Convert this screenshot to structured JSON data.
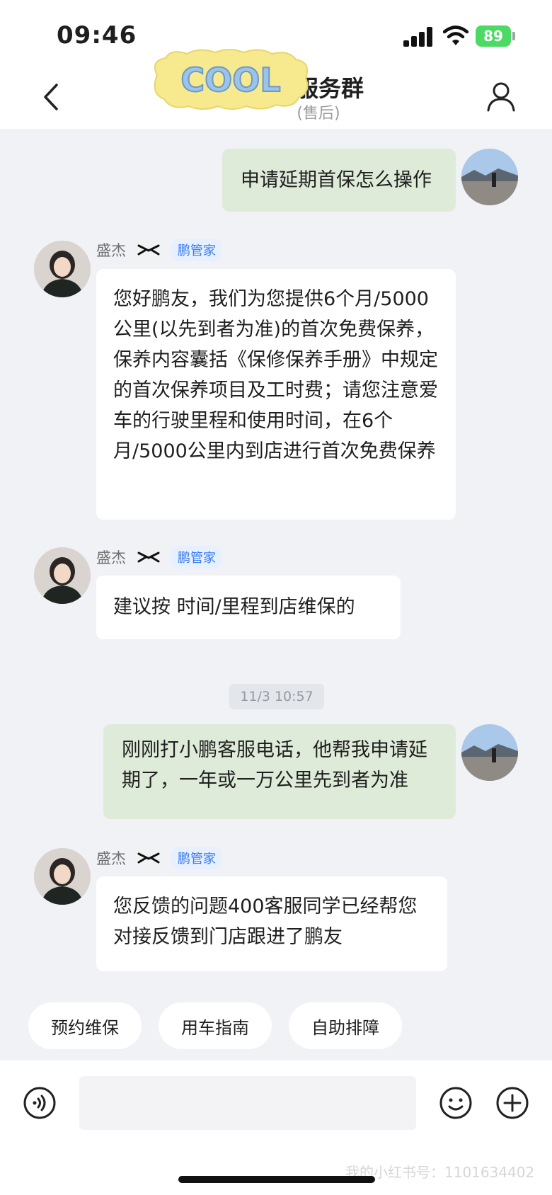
{
  "status_bar": {
    "time": "09:46",
    "battery": "89"
  },
  "header": {
    "title": "家服务群",
    "subtitle": "(售后)",
    "sticker_text": "COOL"
  },
  "messages": [
    {
      "id": "m1",
      "direction": "outgoing",
      "text": "申请延期首保怎么操作"
    },
    {
      "id": "m2",
      "direction": "incoming",
      "sender": "盛杰",
      "role_tag": "鹏管家",
      "text": "您好鹏友，我们为您提供6个月/5000公里(以先到者为准)的首次免费保养，保养内容囊括《保修保养手册》中规定的首次保养项目及工时费；请您注意爱车的行驶里程和使用时间，在6个月/5000公里内到店进行首次免费保养"
    },
    {
      "id": "m3",
      "direction": "incoming",
      "sender": "盛杰",
      "role_tag": "鹏管家",
      "text": "建议按   时间/里程到店维保的"
    },
    {
      "id": "ts1",
      "type": "timestamp",
      "text": "11/3 10:57"
    },
    {
      "id": "m4",
      "direction": "outgoing",
      "text": "刚刚打小鹏客服电话，他帮我申请延期了，一年或一万公里先到者为准"
    },
    {
      "id": "m5",
      "direction": "incoming",
      "sender": "盛杰",
      "role_tag": "鹏管家",
      "text": "您反馈的问题400客服同学已经帮您对接反馈到门店跟进了鹏友"
    }
  ],
  "quick_actions": [
    "预约维保",
    "用车指南",
    "自助排障"
  ],
  "watermark": "我的小红书号：1101634402",
  "colors": {
    "outgoing_bubble": "#dfebd9",
    "incoming_bubble": "#ffffff",
    "role_tag": "#3a7bf0",
    "battery": "#4cd964"
  }
}
